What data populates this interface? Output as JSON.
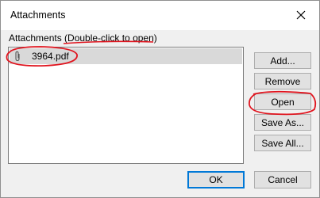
{
  "window": {
    "title": "Attachments"
  },
  "list": {
    "caption_prefix": "Attachments (",
    "caption_link": "Double-click to open",
    "caption_suffix": ")",
    "items": [
      {
        "name": "3964.pdf",
        "icon": "paperclip-icon",
        "selected": true
      }
    ]
  },
  "buttons": {
    "add": "Add...",
    "remove": "Remove",
    "open": "Open",
    "save_as": "Save As...",
    "save_all": "Save All...",
    "ok": "OK",
    "cancel": "Cancel"
  },
  "colors": {
    "annotation": "#e0141e",
    "default_button_border": "#0078d7",
    "selection": "#d9d9d9"
  }
}
